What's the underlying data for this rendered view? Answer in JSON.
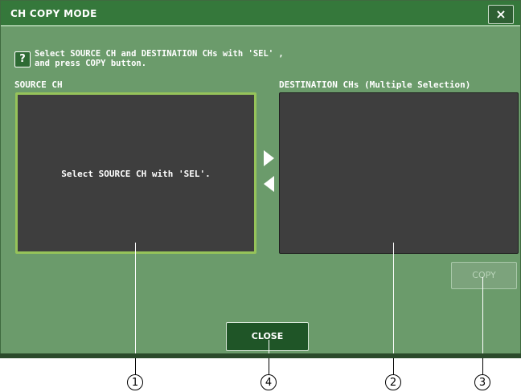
{
  "window": {
    "title": "CH COPY MODE",
    "close_icon": "×"
  },
  "help": {
    "icon": "?",
    "instruction": "Select SOURCE CH and DESTINATION CHs with 'SEL' ,\nand press COPY button."
  },
  "source": {
    "label": "SOURCE CH",
    "message": "Select SOURCE CH with 'SEL'."
  },
  "destination": {
    "label": "DESTINATION CHs (Multiple Selection)"
  },
  "buttons": {
    "copy": "COPY",
    "close": "CLOSE"
  },
  "callouts": [
    "1",
    "4",
    "2",
    "3"
  ],
  "colors": {
    "window_bg": "#6b9b6b",
    "titlebar": "#35783b",
    "panel_bg": "#3e3e3e",
    "selected_border": "#96c35a"
  }
}
